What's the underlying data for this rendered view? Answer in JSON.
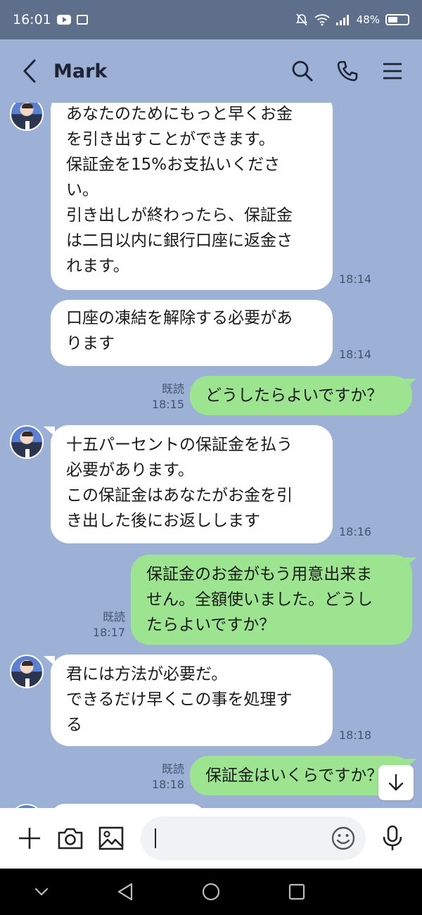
{
  "status_bar": {
    "time": "16:01",
    "battery": "48%"
  },
  "header": {
    "contact_name": "Mark"
  },
  "messages": [
    {
      "lines": [
        "あなたのためにもっと早くお金",
        "を引き出すことができます。",
        "保証金を15%お支払いくださ",
        "い。",
        "引き出しが終わったら、保証金",
        "は二日以内に銀行口座に返金さ",
        "れます。"
      ],
      "time": "18:14"
    },
    {
      "lines": [
        "口座の凍結を解除する必要があ",
        "ります"
      ],
      "time": "18:14"
    },
    {
      "lines": [
        "どうしたらよいですか？"
      ],
      "read": "既読",
      "time": "18:15"
    },
    {
      "lines": [
        "十五パーセントの保証金を払う",
        "必要があります。",
        "この保証金はあなたがお金を引",
        "き出した後にお返しします"
      ],
      "time": "18:16"
    },
    {
      "lines": [
        "保証金のお金がもう用意出来ま",
        "せん。全額使いました。どうし",
        "たらよいですか？"
      ],
      "read": "既読",
      "time": "18:17"
    },
    {
      "lines": [
        "君には方法が必要だ。",
        "できるだけ早くこの事を処理す",
        "る"
      ],
      "time": "18:18"
    },
    {
      "lines": [
        "保証金はいくらですか？"
      ],
      "read": "既読",
      "time": "18:18"
    }
  ],
  "colors": {
    "background": "#9db0d6",
    "incoming_bubble": "#ffffff",
    "outgoing_bubble": "#9de491"
  }
}
